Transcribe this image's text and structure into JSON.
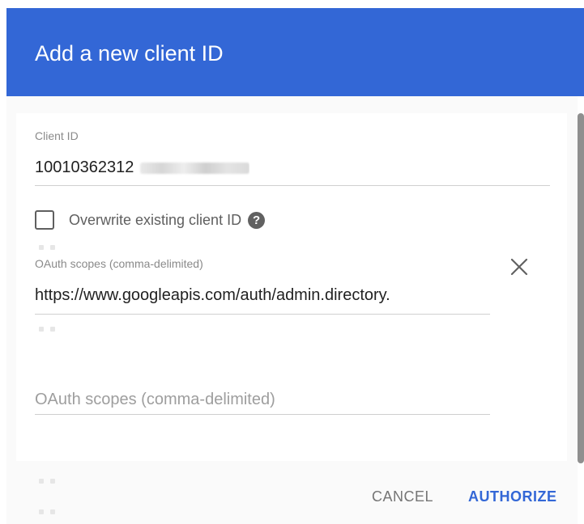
{
  "dialog": {
    "title": "Add a new client ID"
  },
  "client_id": {
    "label": "Client ID",
    "value": "10010362312"
  },
  "overwrite": {
    "label": "Overwrite existing client ID",
    "checked": false,
    "help_icon": "help-circle-icon"
  },
  "scopes_1": {
    "label": "OAuth scopes (comma-delimited)",
    "value": "https://www.googleapis.com/auth/admin.directory."
  },
  "scopes_2": {
    "placeholder": "OAuth scopes (comma-delimited)"
  },
  "actions": {
    "cancel_label": "CANCEL",
    "authorize_label": "AUTHORIZE"
  },
  "colors": {
    "header": "#3367d6",
    "primary_button": "#3367d6",
    "secondary_button": "#757575"
  },
  "icons": {
    "close": "close-icon",
    "help": "help-circle-icon"
  }
}
